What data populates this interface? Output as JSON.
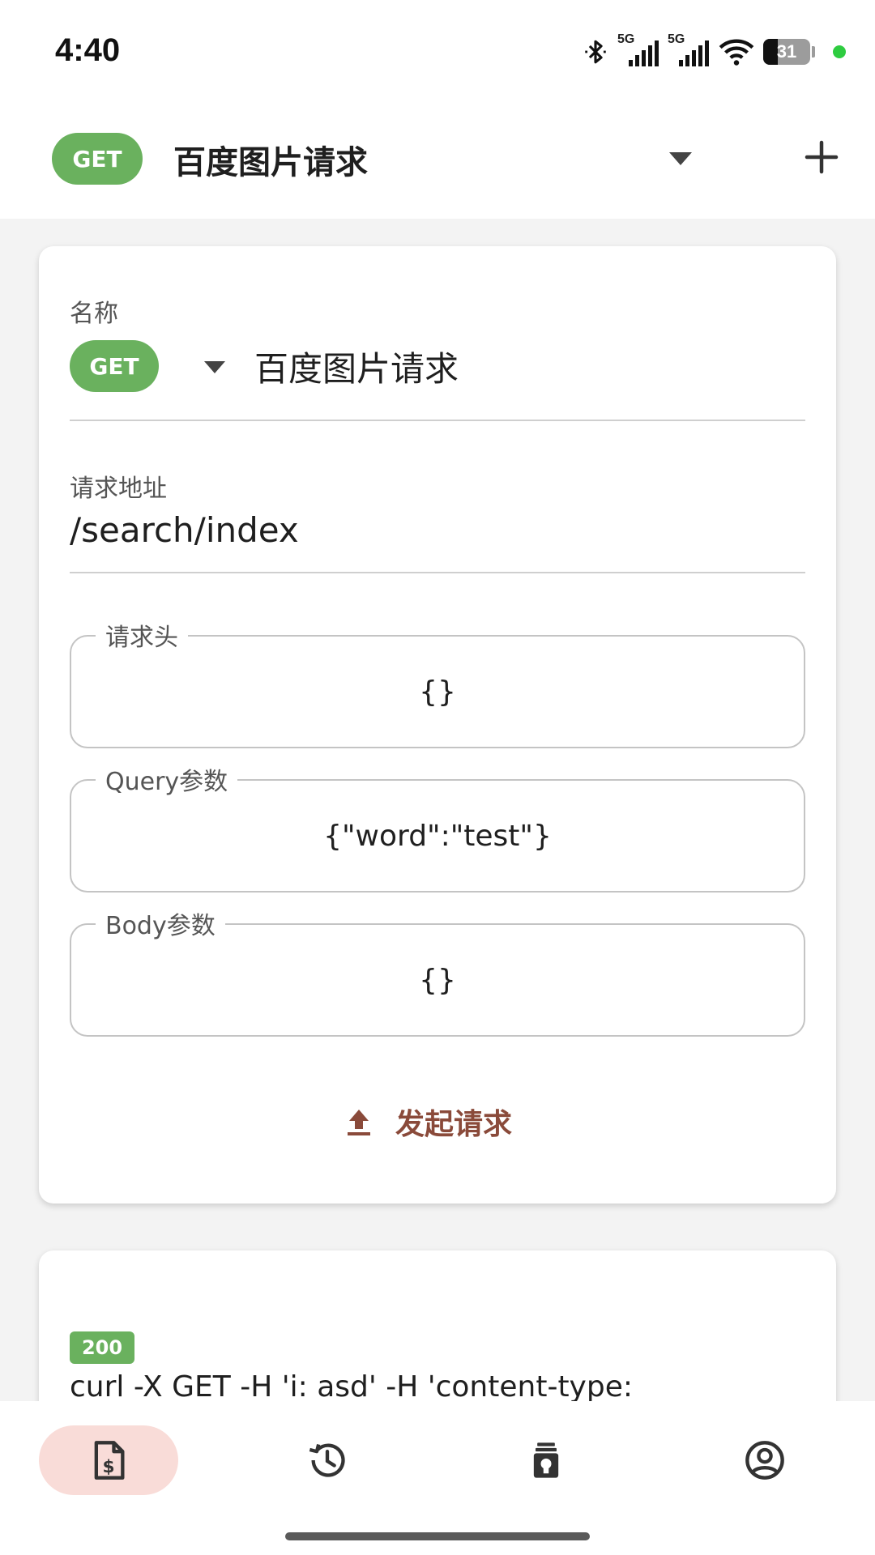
{
  "status_bar": {
    "time": "4:40",
    "network_1": "5G",
    "network_2": "5G",
    "battery": "31",
    "battery_level": 0.31
  },
  "app_bar": {
    "method": "GET",
    "title": "百度图片请求"
  },
  "request": {
    "name_label": "名称",
    "method": "GET",
    "name_value": "百度图片请求",
    "url_label": "请求地址",
    "url_value": "/search/index",
    "headers_label": "请求头",
    "headers_value": "{}",
    "query_label": "Query参数",
    "query_value": "{\"word\":\"test\"}",
    "body_label": "Body参数",
    "body_value": "{}",
    "send_label": "发起请求"
  },
  "response": {
    "status_code": "200",
    "curl": "curl -X GET -H 'i: asd' -H 'content-type:"
  },
  "bottom_nav": [
    {
      "icon": "request-document-icon",
      "active": true
    },
    {
      "icon": "history-icon",
      "active": false
    },
    {
      "icon": "tips-lightbulb-icon",
      "active": false
    },
    {
      "icon": "account-icon",
      "active": false
    }
  ],
  "colors": {
    "method_green": "#6ab15e",
    "accent_brown": "#8a4a3a",
    "nav_active_bg": "#f9dcd8"
  }
}
